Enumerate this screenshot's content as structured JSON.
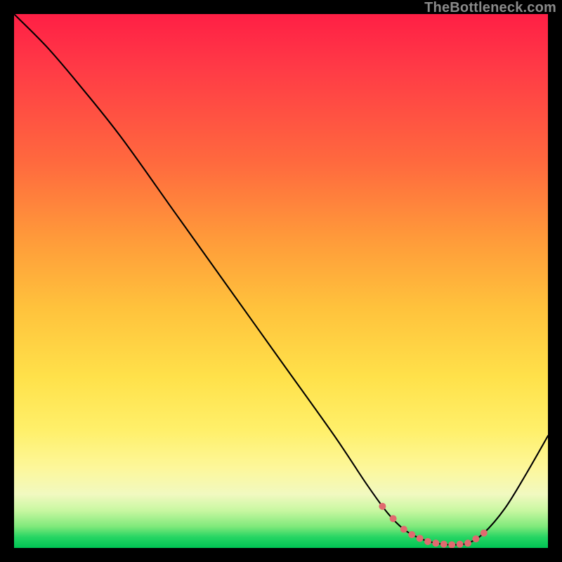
{
  "watermark": "TheBottleneck.com",
  "chart_data": {
    "type": "line",
    "title": "",
    "xlabel": "",
    "ylabel": "",
    "xlim": [
      0,
      100
    ],
    "ylim": [
      0,
      100
    ],
    "grid": false,
    "legend": false,
    "series": [
      {
        "name": "bottleneck-curve",
        "x": [
          0,
          6,
          12,
          20,
          30,
          40,
          50,
          60,
          66,
          70,
          73,
          76,
          79,
          82,
          85,
          88,
          92,
          96,
          100
        ],
        "y": [
          100,
          94,
          87,
          77,
          63,
          49,
          35,
          21,
          12,
          6.5,
          3.5,
          1.8,
          0.9,
          0.6,
          0.9,
          2.8,
          7.5,
          14,
          21
        ]
      }
    ],
    "highlight_dots": {
      "name": "optimal-region",
      "x": [
        69,
        71,
        73,
        74.5,
        76,
        77.5,
        79,
        80.5,
        82,
        83.5,
        85,
        86.5,
        88
      ],
      "y": [
        7.8,
        5.5,
        3.5,
        2.5,
        1.8,
        1.2,
        0.9,
        0.7,
        0.6,
        0.7,
        0.9,
        1.7,
        2.8
      ]
    },
    "background": "rainbow-vertical-gradient"
  }
}
